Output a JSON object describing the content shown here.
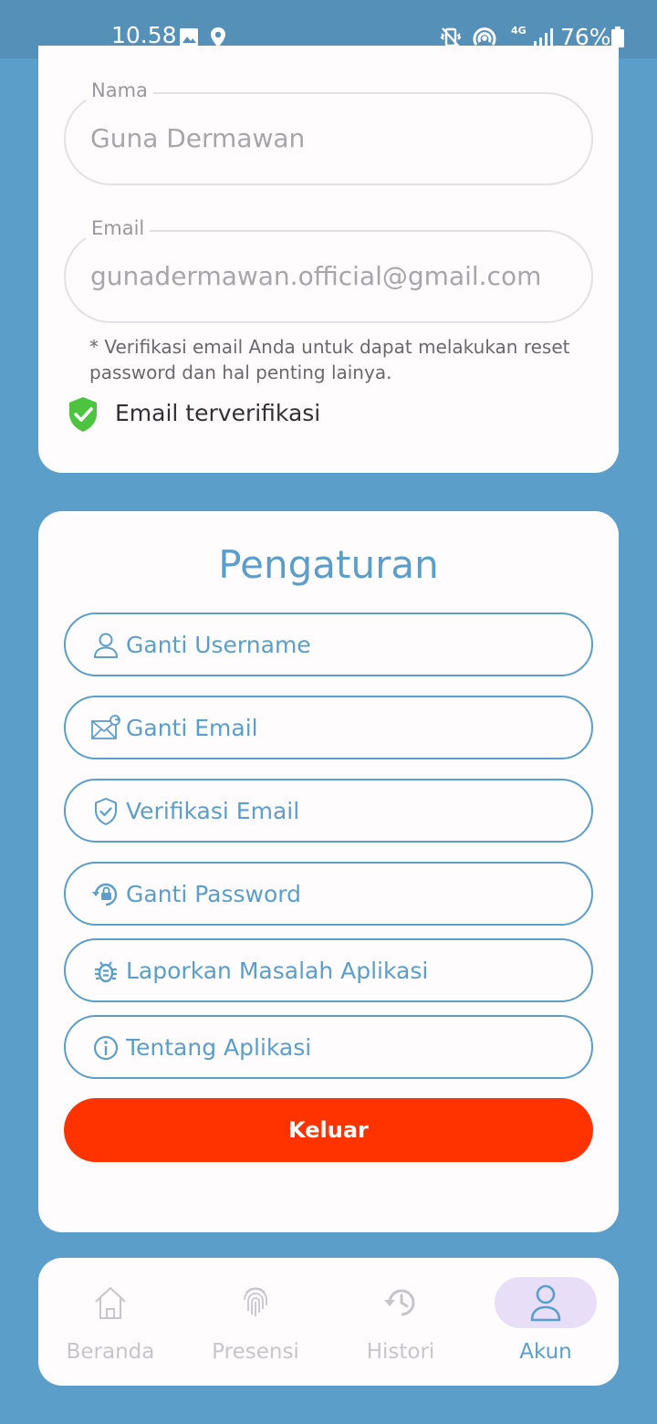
{
  "status_bar": {
    "time": "10.58",
    "network": "4G",
    "battery": "76%",
    "icons": [
      "image-icon",
      "location-icon",
      "vibrate-off-icon",
      "hotspot-icon",
      "signal-icon",
      "battery-icon"
    ]
  },
  "profile": {
    "name_label": "Nama",
    "name_value": "Guna Dermawan",
    "email_label": "Email",
    "email_value": "gunadermawan.official@gmail.com",
    "email_note": "* Verifikasi email Anda untuk dapat melakukan reset password dan hal penting lainya.",
    "verified_text": "Email terverifikasi",
    "verified_color": "#4cc43f"
  },
  "settings": {
    "title": "Pengaturan",
    "options": [
      {
        "label": "Ganti Username",
        "icon": "user-icon"
      },
      {
        "label": "Ganti Email",
        "icon": "mail-refresh-icon"
      },
      {
        "label": "Verifikasi Email",
        "icon": "shield-check-icon"
      },
      {
        "label": "Ganti Password",
        "icon": "lock-reset-icon"
      },
      {
        "label": "Laporkan Masalah Aplikasi",
        "icon": "bug-icon"
      },
      {
        "label": "Tentang Aplikasi",
        "icon": "info-icon"
      }
    ],
    "logout_label": "Keluar"
  },
  "bottom_nav": {
    "items": [
      {
        "label": "Beranda",
        "icon": "home-icon",
        "active": false
      },
      {
        "label": "Presensi",
        "icon": "fingerprint-icon",
        "active": false
      },
      {
        "label": "Histori",
        "icon": "history-icon",
        "active": false
      },
      {
        "label": "Akun",
        "icon": "account-icon",
        "active": true
      }
    ]
  },
  "colors": {
    "background": "#5b9ec9",
    "status_bar": "#5590b9",
    "card": "#fffcfd",
    "accent": "#5b9ec9",
    "logout": "#ff3300",
    "active_pill": "#e8def8"
  }
}
